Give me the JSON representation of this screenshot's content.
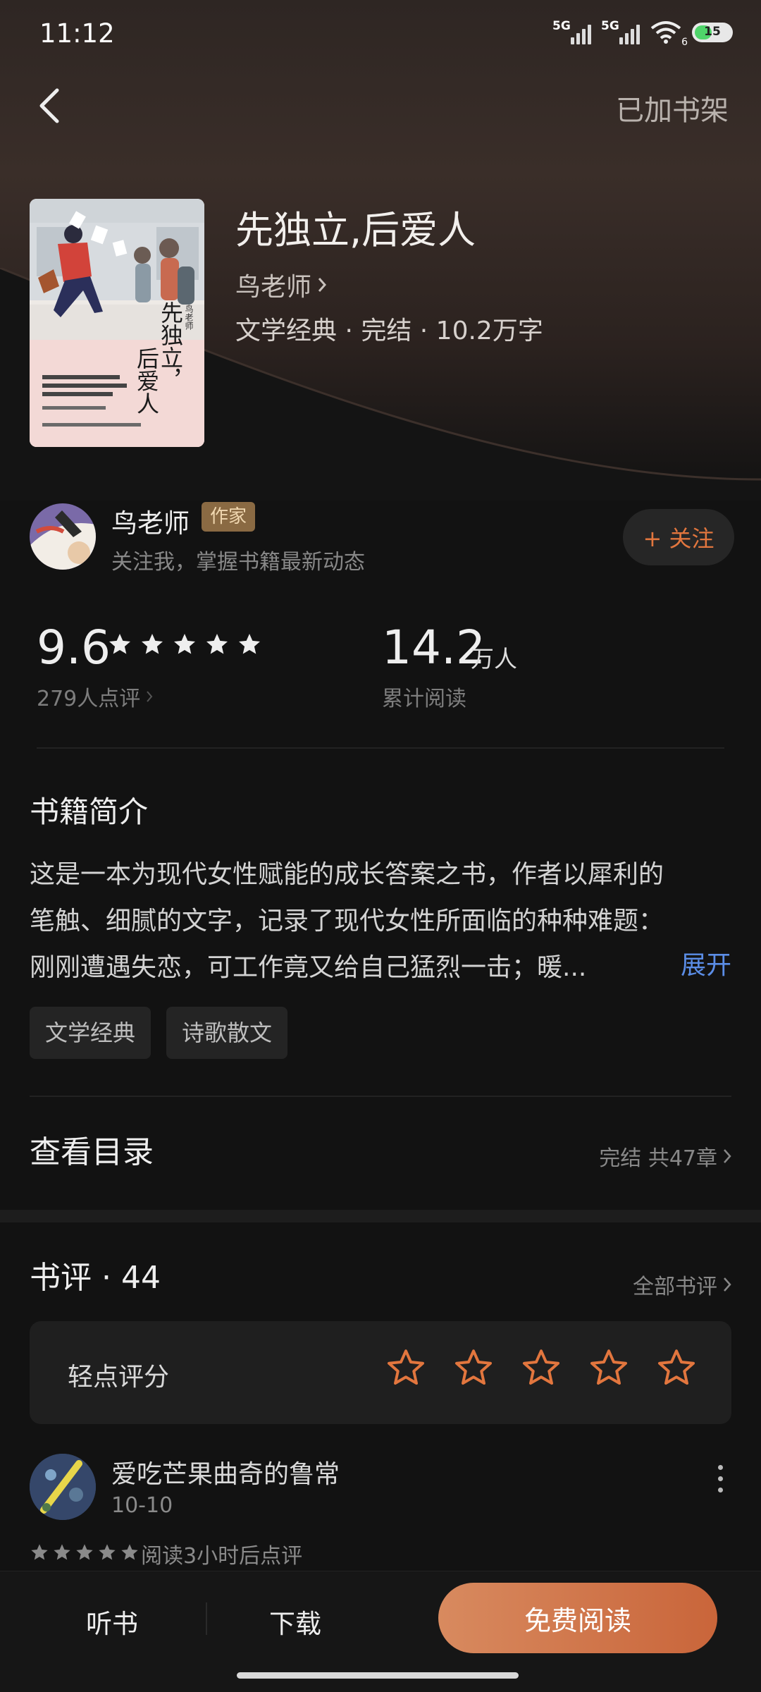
{
  "status_bar": {
    "time": "11:12",
    "network_1": "5G",
    "network_2": "5G",
    "wifi_sub": "6",
    "battery": "15"
  },
  "header": {
    "shelf_label": "已加书架"
  },
  "book": {
    "title": "先独立,后爱人",
    "author": "鸟老师",
    "meta": "文学经典 · 完结 · 10.2万字",
    "cover_title": "先独立，后爱人",
    "cover_author": "鸟老师"
  },
  "author_card": {
    "name": "鸟老师",
    "badge": "作家",
    "subtitle": "关注我，掌握书籍最新动态",
    "follow_label": "+ 关注"
  },
  "stats": {
    "score": "9.6",
    "score_stars": 5,
    "rating_count": "279人点评",
    "reads_value": "14.2",
    "reads_unit": "万人",
    "reads_label": "累计阅读"
  },
  "intro": {
    "title": "书籍简介",
    "lines": [
      "这是一本为现代女性赋能的成长答案之书，作者以犀利的",
      "笔触、细腻的文字，记录了现代女性所面临的种种难题：",
      "刚刚遭遇失恋，可工作竟又给自己猛烈一击；暖..."
    ],
    "expand_label": "展开",
    "tags": [
      "文学经典",
      "诗歌散文"
    ]
  },
  "toc": {
    "title": "查看目录",
    "info": "完结 共47章"
  },
  "reviews": {
    "title": "书评 · 44",
    "all_label": "全部书评",
    "rate_label": "轻点评分",
    "rate_stars": 5,
    "items": [
      {
        "user": "爱吃芒果曲奇的鲁常",
        "date": "10-10",
        "stars": 5,
        "note": "阅读3小时后点评"
      }
    ]
  },
  "bottom_bar": {
    "listen": "听书",
    "download": "下载",
    "read": "免费阅读"
  },
  "colors": {
    "accent": "#e2763e",
    "link": "#5b8de6",
    "background": "#121212",
    "badge": "#8a6a43"
  }
}
